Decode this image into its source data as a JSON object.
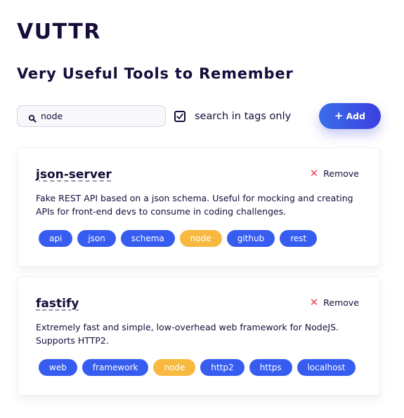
{
  "header": {
    "title": "VUTTR",
    "subtitle": "Very Useful Tools to Remember"
  },
  "search": {
    "value": "node",
    "placeholder": "",
    "tags_only_label": "search in tags only",
    "tags_only_checked": true
  },
  "toolbar": {
    "add_icon": "+",
    "add_label": "Add"
  },
  "colors": {
    "tag": "#365df0",
    "tag_highlight": "#f8b941",
    "remove_icon": "#f0424f",
    "text": "#170c3a"
  },
  "tools": [
    {
      "title": "json-server",
      "remove_icon": "✕",
      "remove_label": "Remove",
      "description": "Fake REST API based on a json schema. Useful for mocking and creating APIs for front-end devs to consume in coding challenges.",
      "tags": [
        "api",
        "json",
        "schema",
        "node",
        "github",
        "rest"
      ]
    },
    {
      "title": "fastify",
      "remove_icon": "✕",
      "remove_label": "Remove",
      "description": "Extremely fast and simple, low-overhead web framework for NodeJS. Supports HTTP2.",
      "tags": [
        "web",
        "framework",
        "node",
        "http2",
        "https",
        "localhost"
      ]
    }
  ]
}
